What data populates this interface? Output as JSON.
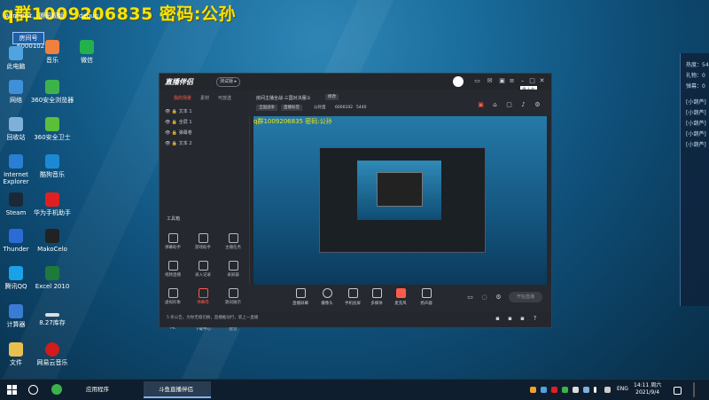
{
  "overlay_caption": "q群1009206835 密码:公孙",
  "desktop": {
    "room_badge": "房间号",
    "room_number": "6000102",
    "top_labels": [
      "Administ...",
      "腾讯视频",
      "debug"
    ],
    "icons": [
      {
        "label": "此电脑",
        "color": "#4fa3e0"
      },
      {
        "label": "音乐",
        "color": "#f08040"
      },
      {
        "label": "微信",
        "color": "#22b14c"
      },
      {
        "label": "网络",
        "color": "#3f90d8"
      },
      {
        "label": "360安全浏览器",
        "color": "#3cb34a"
      },
      {
        "label": "回收站",
        "color": "#7fb0d8"
      },
      {
        "label": "360安全卫士",
        "color": "#5cbf3a"
      },
      {
        "label": "Internet Explorer",
        "color": "#2a7fd4"
      },
      {
        "label": "酷狗音乐",
        "color": "#1a8ad4"
      },
      {
        "label": "Steam",
        "color": "#1b2838"
      },
      {
        "label": "华为手机助手",
        "color": "#e02020"
      },
      {
        "label": "Thunder",
        "color": "#2a6bd8"
      },
      {
        "label": "MakoCelo",
        "color": "#222"
      },
      {
        "label": "腾讯QQ",
        "color": "#1aa1e8"
      },
      {
        "label": "Excel 2010",
        "color": "#1e7a3a"
      },
      {
        "label": "计算器",
        "color": "#3a7bd5"
      },
      {
        "label": "8.27库存",
        "color": "#ddd"
      },
      {
        "label": "文件",
        "color": "#e8c050"
      },
      {
        "label": "网易云音乐",
        "color": "#d01c1c"
      }
    ]
  },
  "app": {
    "logo": "直播伴侣",
    "beta": "测试版 ▸",
    "tooltip": "最小化",
    "tabs": [
      "我的场景",
      "素材",
      "可放送"
    ],
    "scenes": [
      "文本 1",
      "全屏 1",
      "弹幕卷",
      "文本 2"
    ],
    "tools_title": "工具箱",
    "tools": [
      "弹幕助手",
      "游戏助手",
      "主播任务",
      "视频直播",
      "录入记录",
      "录屏器",
      "虚拟形象",
      "弹幕卷",
      "歌词展示",
      "PK",
      "下载中心",
      "配音"
    ],
    "notice": "5 条公告。为你无缝切换，直播推动行，第上一直播",
    "stream_title": "房间主播全战·三国对决服斗",
    "edit_label": "修改",
    "chips": [
      "全国战争",
      "直播标签",
      "公孙直",
      "6000102",
      "5440"
    ],
    "controls": [
      "直播屏幕",
      "摄像头",
      "手机投屏",
      "多媒体",
      "麦克风",
      "扬声器"
    ],
    "start_button": "开始直播"
  },
  "sidepanel": {
    "lines": [
      "热度：54",
      "礼物：0",
      "弹幕：0",
      "[小葫芦]",
      "[小葫芦]",
      "[小葫芦]",
      "[小葫芦]",
      "[小葫芦]"
    ]
  },
  "taskbar": {
    "items": [
      "应用程序",
      "斗鱼直播伴侣"
    ],
    "tray": {
      "lang": "ENG",
      "time": "14:11 周六",
      "date": "2021/9/4"
    }
  }
}
